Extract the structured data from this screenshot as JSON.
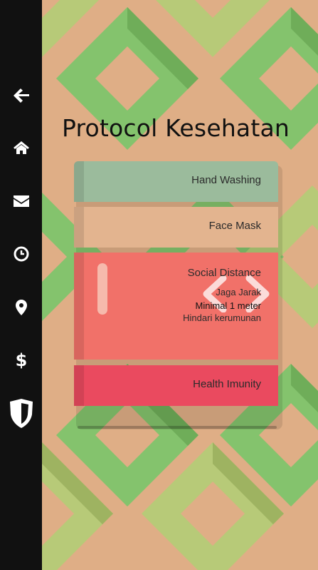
{
  "page": {
    "title": "Protocol Kesehatan"
  },
  "sidebar": {
    "items": [
      {
        "icon": "arrow-left-icon"
      },
      {
        "icon": "home-icon"
      },
      {
        "icon": "envelope-icon"
      },
      {
        "icon": "clock-icon"
      },
      {
        "icon": "map-marker-icon"
      },
      {
        "icon": "dollar-icon"
      },
      {
        "icon": "shield-icon"
      }
    ]
  },
  "cards": [
    {
      "label": "Hand Washing",
      "color": "#9bbb9c"
    },
    {
      "label": "Face Mask",
      "color": "#e3b48f"
    },
    {
      "label": "Social Distance",
      "color": "#f17169",
      "details": [
        "Jaga Jarak",
        "Minimal 1 meter",
        "Hindari kerumunan"
      ]
    },
    {
      "label": "Health Imunity",
      "color": "#ea4a5f"
    }
  ],
  "colors": {
    "background": "#dfae86",
    "pattern_green": "#7fc56c",
    "pattern_olive": "#b5cc78",
    "sidebar": "#111111"
  }
}
